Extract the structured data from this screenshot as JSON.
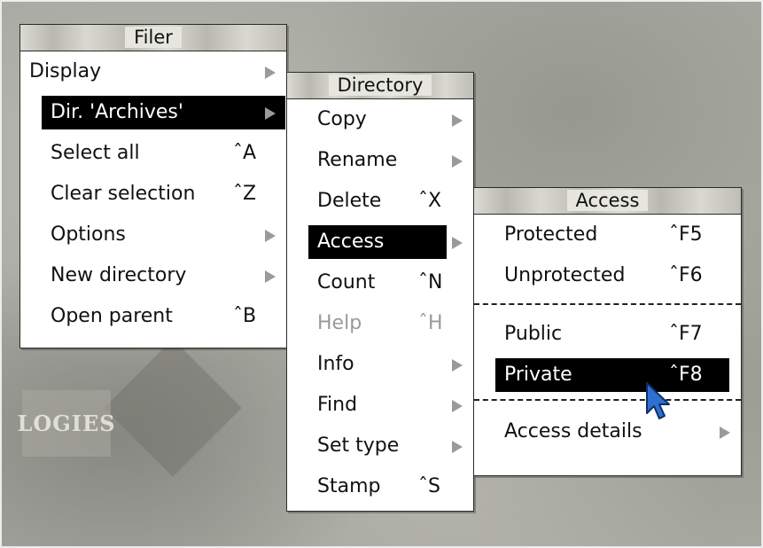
{
  "background_logo_text": "LOGIES",
  "menus": {
    "filer": {
      "title": "Filer",
      "items": [
        {
          "label": "Display",
          "shortcut": "",
          "has_submenu": true
        },
        {
          "label": "Dir. 'Archives'",
          "shortcut": "",
          "has_submenu": true,
          "selected": true
        },
        {
          "label": "Select all",
          "shortcut": "ˆA",
          "has_submenu": false
        },
        {
          "label": "Clear selection",
          "shortcut": "ˆZ",
          "has_submenu": false
        },
        {
          "label": "Options",
          "shortcut": "",
          "has_submenu": true
        },
        {
          "label": "New directory",
          "shortcut": "",
          "has_submenu": true
        },
        {
          "label": "Open parent",
          "shortcut": "ˆB",
          "has_submenu": false
        }
      ]
    },
    "directory": {
      "title": "Directory",
      "items": [
        {
          "label": "Copy",
          "shortcut": "",
          "has_submenu": true
        },
        {
          "label": "Rename",
          "shortcut": "",
          "has_submenu": true
        },
        {
          "label": "Delete",
          "shortcut": "ˆX",
          "has_submenu": false
        },
        {
          "label": "Access",
          "shortcut": "",
          "has_submenu": true,
          "selected": true
        },
        {
          "label": "Count",
          "shortcut": "ˆN",
          "has_submenu": false
        },
        {
          "label": "Help",
          "shortcut": "ˆH",
          "has_submenu": false,
          "disabled": true
        },
        {
          "label": "Info",
          "shortcut": "",
          "has_submenu": true
        },
        {
          "label": "Find",
          "shortcut": "",
          "has_submenu": true
        },
        {
          "label": "Set type",
          "shortcut": "",
          "has_submenu": true
        },
        {
          "label": "Stamp",
          "shortcut": "ˆS",
          "has_submenu": false
        }
      ]
    },
    "access": {
      "title": "Access",
      "items": [
        {
          "label": "Protected",
          "shortcut": "ˆF5",
          "has_submenu": false
        },
        {
          "label": "Unprotected",
          "shortcut": "ˆF6",
          "has_submenu": false
        },
        {
          "label": "Public",
          "shortcut": "ˆF7",
          "has_submenu": false
        },
        {
          "label": "Private",
          "shortcut": "ˆF8",
          "has_submenu": false,
          "selected": true
        },
        {
          "label": "Access details",
          "shortcut": "",
          "has_submenu": true
        }
      ]
    }
  },
  "colors": {
    "highlight": "#000000",
    "highlight_text": "#ffffff",
    "disabled_text": "#9a9a9a",
    "submenu_arrow": "#9a9a9a",
    "pointer": "#2f6fd0"
  },
  "icons": {
    "submenu_arrow": "submenu-arrow-icon",
    "pointer": "mouse-pointer-icon"
  }
}
